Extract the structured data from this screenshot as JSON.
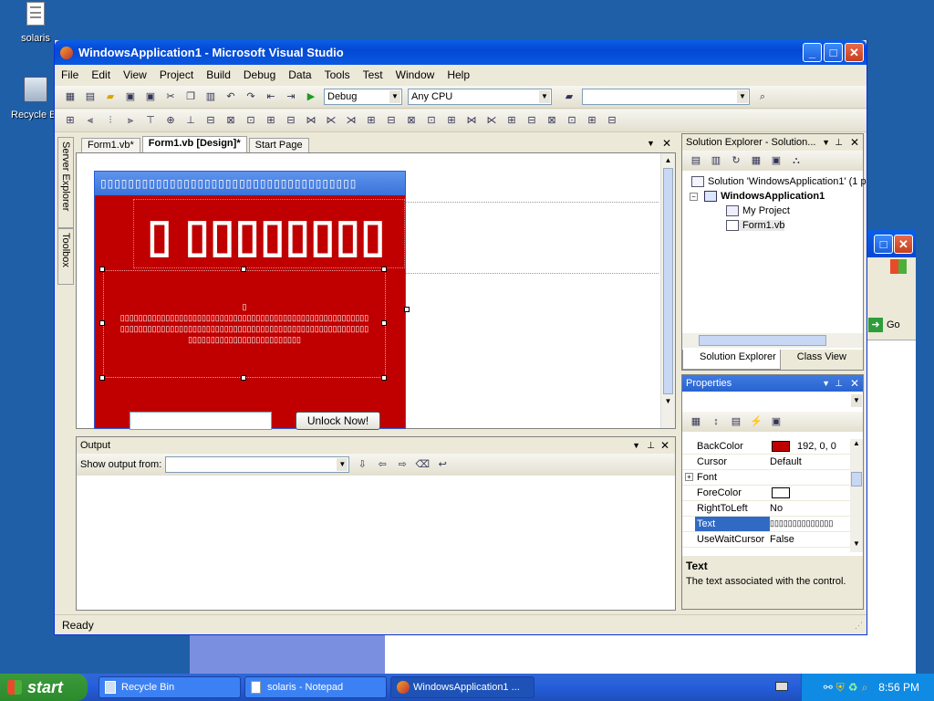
{
  "desktop": {
    "icons": [
      {
        "label": "solaris"
      },
      {
        "label": "Recycle Bin"
      }
    ]
  },
  "bg_window": {
    "go_label": "Go"
  },
  "window": {
    "title": "WindowsApplication1 - Microsoft Visual Studio",
    "min": "_",
    "max": "□",
    "close": "✕"
  },
  "menu": [
    "File",
    "Edit",
    "View",
    "Project",
    "Build",
    "Debug",
    "Data",
    "Tools",
    "Test",
    "Window",
    "Help"
  ],
  "toolbar": {
    "config": "Debug",
    "platform": "Any CPU"
  },
  "side_tabs": {
    "server_explorer": "Server Explorer",
    "toolbox": "Toolbox"
  },
  "doc_tabs": [
    {
      "label": "Form1.vb*"
    },
    {
      "label": "Form1.vb [Design]*"
    },
    {
      "label": "Start Page"
    }
  ],
  "form": {
    "title": "▯▯▯▯▯▯▯▯▯▯▯▯▯▯▯▯▯▯▯▯▯▯▯▯▯▯▯▯▯▯▯▯▯▯▯▯▯",
    "big_text": "▯ ▯▯▯▯▯▯▯▯",
    "body_lines": [
      "▯",
      "▯▯▯▯▯▯▯▯▯▯▯▯▯▯▯▯▯▯▯▯▯▯▯▯▯▯▯▯▯▯▯▯▯▯▯▯▯▯▯▯▯▯▯▯▯▯▯▯▯▯▯▯▯▯▯",
      "▯▯▯▯▯▯▯▯▯▯▯▯▯▯▯▯▯▯▯▯▯▯▯▯▯▯▯▯▯▯▯▯▯▯▯▯▯▯▯▯▯▯▯▯▯▯▯▯▯▯▯▯▯▯▯",
      "▯▯▯▯▯▯▯▯▯▯▯▯▯▯▯▯▯▯▯▯▯▯▯▯▯"
    ],
    "unlock_button": "Unlock Now!",
    "backcolor_hex": "#c00000"
  },
  "output": {
    "title": "Output",
    "show_from": "Show output from:"
  },
  "solution_explorer": {
    "title": "Solution Explorer - Solution...",
    "solution": "Solution 'WindowsApplication1' (1 p",
    "project": "WindowsApplication1",
    "my_project": "My Project",
    "form": "Form1.vb",
    "tab1": "Solution Explorer",
    "tab2": "Class View"
  },
  "properties": {
    "title": "Properties",
    "rows": [
      {
        "key": "BackColor",
        "value": "192, 0, 0"
      },
      {
        "key": "Cursor",
        "value": "Default"
      },
      {
        "key": "Font",
        "value": ""
      },
      {
        "key": "ForeColor",
        "value": ""
      },
      {
        "key": "RightToLeft",
        "value": "No"
      },
      {
        "key": "Text",
        "value": "▯▯▯▯▯▯▯▯▯▯▯▯▯▯"
      },
      {
        "key": "UseWaitCursor",
        "value": "False"
      }
    ],
    "desc_title": "Text",
    "desc_text": "The text associated with the control."
  },
  "status": {
    "text": "Ready"
  },
  "taskbar": {
    "start": "start",
    "tasks": [
      {
        "label": "Recycle Bin"
      },
      {
        "label": "solaris - Notepad"
      },
      {
        "label": "WindowsApplication1 ..."
      }
    ],
    "clock": "8:56 PM"
  }
}
